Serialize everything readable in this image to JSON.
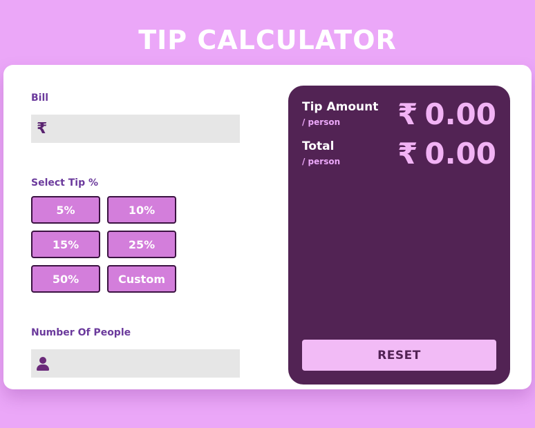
{
  "app": {
    "title": "TIP CALCULATOR"
  },
  "bill": {
    "label": "Bill",
    "currency_symbol": "₹",
    "value": "",
    "placeholder": ""
  },
  "tip": {
    "label": "Select Tip %",
    "options": [
      "5%",
      "10%",
      "15%",
      "25%",
      "50%",
      "Custom"
    ]
  },
  "people": {
    "label": "Number Of People",
    "icon": "person-icon",
    "value": "",
    "placeholder": ""
  },
  "results": {
    "tip_amount": {
      "label": "Tip Amount",
      "sub": "/ person",
      "currency": "₹",
      "value": "0.00"
    },
    "total": {
      "label": "Total",
      "sub": "/ person",
      "currency": "₹",
      "value": "0.00"
    },
    "reset_label": "RESET"
  },
  "colors": {
    "background": "#eba7f8",
    "card": "#ffffff",
    "label_text": "#6b3a9c",
    "input_bg": "#e6e6e6",
    "tip_button": "#d37edb",
    "tip_button_border": "#3a1240",
    "result_panel": "#522354",
    "result_value": "#f2b3f5",
    "reset_button": "#f2bbf6"
  }
}
